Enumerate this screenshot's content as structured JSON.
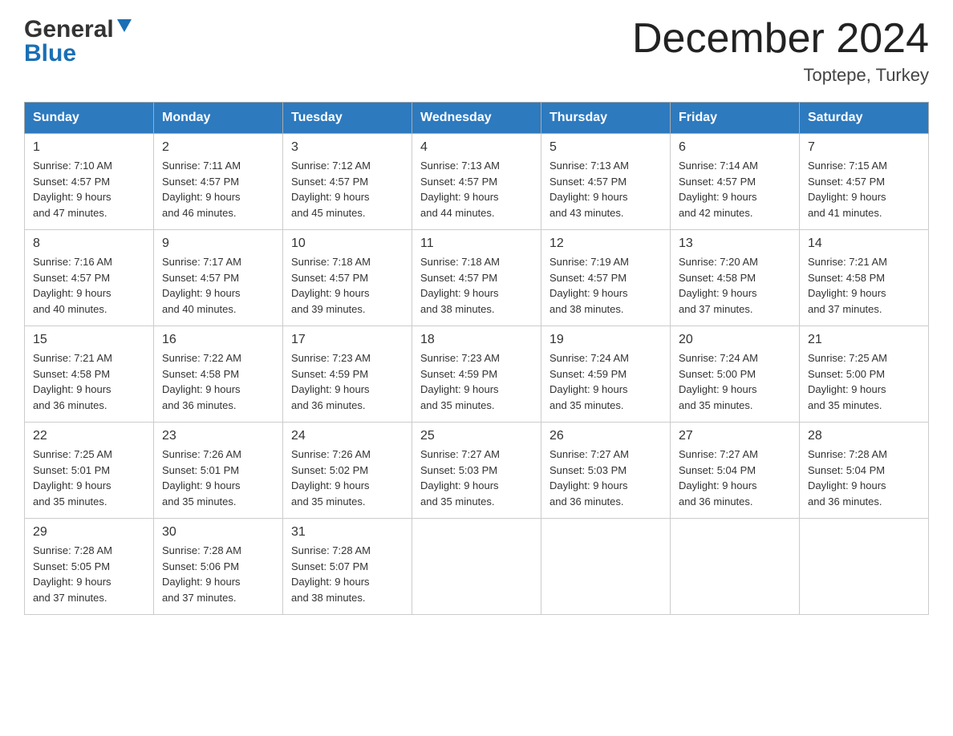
{
  "header": {
    "logo_general": "General",
    "logo_blue": "Blue",
    "title": "December 2024",
    "subtitle": "Toptepe, Turkey"
  },
  "weekdays": [
    "Sunday",
    "Monday",
    "Tuesday",
    "Wednesday",
    "Thursday",
    "Friday",
    "Saturday"
  ],
  "weeks": [
    [
      {
        "day": "1",
        "sunrise": "7:10 AM",
        "sunset": "4:57 PM",
        "daylight": "9 hours and 47 minutes."
      },
      {
        "day": "2",
        "sunrise": "7:11 AM",
        "sunset": "4:57 PM",
        "daylight": "9 hours and 46 minutes."
      },
      {
        "day": "3",
        "sunrise": "7:12 AM",
        "sunset": "4:57 PM",
        "daylight": "9 hours and 45 minutes."
      },
      {
        "day": "4",
        "sunrise": "7:13 AM",
        "sunset": "4:57 PM",
        "daylight": "9 hours and 44 minutes."
      },
      {
        "day": "5",
        "sunrise": "7:13 AM",
        "sunset": "4:57 PM",
        "daylight": "9 hours and 43 minutes."
      },
      {
        "day": "6",
        "sunrise": "7:14 AM",
        "sunset": "4:57 PM",
        "daylight": "9 hours and 42 minutes."
      },
      {
        "day": "7",
        "sunrise": "7:15 AM",
        "sunset": "4:57 PM",
        "daylight": "9 hours and 41 minutes."
      }
    ],
    [
      {
        "day": "8",
        "sunrise": "7:16 AM",
        "sunset": "4:57 PM",
        "daylight": "9 hours and 40 minutes."
      },
      {
        "day": "9",
        "sunrise": "7:17 AM",
        "sunset": "4:57 PM",
        "daylight": "9 hours and 40 minutes."
      },
      {
        "day": "10",
        "sunrise": "7:18 AM",
        "sunset": "4:57 PM",
        "daylight": "9 hours and 39 minutes."
      },
      {
        "day": "11",
        "sunrise": "7:18 AM",
        "sunset": "4:57 PM",
        "daylight": "9 hours and 38 minutes."
      },
      {
        "day": "12",
        "sunrise": "7:19 AM",
        "sunset": "4:57 PM",
        "daylight": "9 hours and 38 minutes."
      },
      {
        "day": "13",
        "sunrise": "7:20 AM",
        "sunset": "4:58 PM",
        "daylight": "9 hours and 37 minutes."
      },
      {
        "day": "14",
        "sunrise": "7:21 AM",
        "sunset": "4:58 PM",
        "daylight": "9 hours and 37 minutes."
      }
    ],
    [
      {
        "day": "15",
        "sunrise": "7:21 AM",
        "sunset": "4:58 PM",
        "daylight": "9 hours and 36 minutes."
      },
      {
        "day": "16",
        "sunrise": "7:22 AM",
        "sunset": "4:58 PM",
        "daylight": "9 hours and 36 minutes."
      },
      {
        "day": "17",
        "sunrise": "7:23 AM",
        "sunset": "4:59 PM",
        "daylight": "9 hours and 36 minutes."
      },
      {
        "day": "18",
        "sunrise": "7:23 AM",
        "sunset": "4:59 PM",
        "daylight": "9 hours and 35 minutes."
      },
      {
        "day": "19",
        "sunrise": "7:24 AM",
        "sunset": "4:59 PM",
        "daylight": "9 hours and 35 minutes."
      },
      {
        "day": "20",
        "sunrise": "7:24 AM",
        "sunset": "5:00 PM",
        "daylight": "9 hours and 35 minutes."
      },
      {
        "day": "21",
        "sunrise": "7:25 AM",
        "sunset": "5:00 PM",
        "daylight": "9 hours and 35 minutes."
      }
    ],
    [
      {
        "day": "22",
        "sunrise": "7:25 AM",
        "sunset": "5:01 PM",
        "daylight": "9 hours and 35 minutes."
      },
      {
        "day": "23",
        "sunrise": "7:26 AM",
        "sunset": "5:01 PM",
        "daylight": "9 hours and 35 minutes."
      },
      {
        "day": "24",
        "sunrise": "7:26 AM",
        "sunset": "5:02 PM",
        "daylight": "9 hours and 35 minutes."
      },
      {
        "day": "25",
        "sunrise": "7:27 AM",
        "sunset": "5:03 PM",
        "daylight": "9 hours and 35 minutes."
      },
      {
        "day": "26",
        "sunrise": "7:27 AM",
        "sunset": "5:03 PM",
        "daylight": "9 hours and 36 minutes."
      },
      {
        "day": "27",
        "sunrise": "7:27 AM",
        "sunset": "5:04 PM",
        "daylight": "9 hours and 36 minutes."
      },
      {
        "day": "28",
        "sunrise": "7:28 AM",
        "sunset": "5:04 PM",
        "daylight": "9 hours and 36 minutes."
      }
    ],
    [
      {
        "day": "29",
        "sunrise": "7:28 AM",
        "sunset": "5:05 PM",
        "daylight": "9 hours and 37 minutes."
      },
      {
        "day": "30",
        "sunrise": "7:28 AM",
        "sunset": "5:06 PM",
        "daylight": "9 hours and 37 minutes."
      },
      {
        "day": "31",
        "sunrise": "7:28 AM",
        "sunset": "5:07 PM",
        "daylight": "9 hours and 38 minutes."
      },
      null,
      null,
      null,
      null
    ]
  ],
  "labels": {
    "sunrise_prefix": "Sunrise: ",
    "sunset_prefix": "Sunset: ",
    "daylight_prefix": "Daylight: "
  }
}
